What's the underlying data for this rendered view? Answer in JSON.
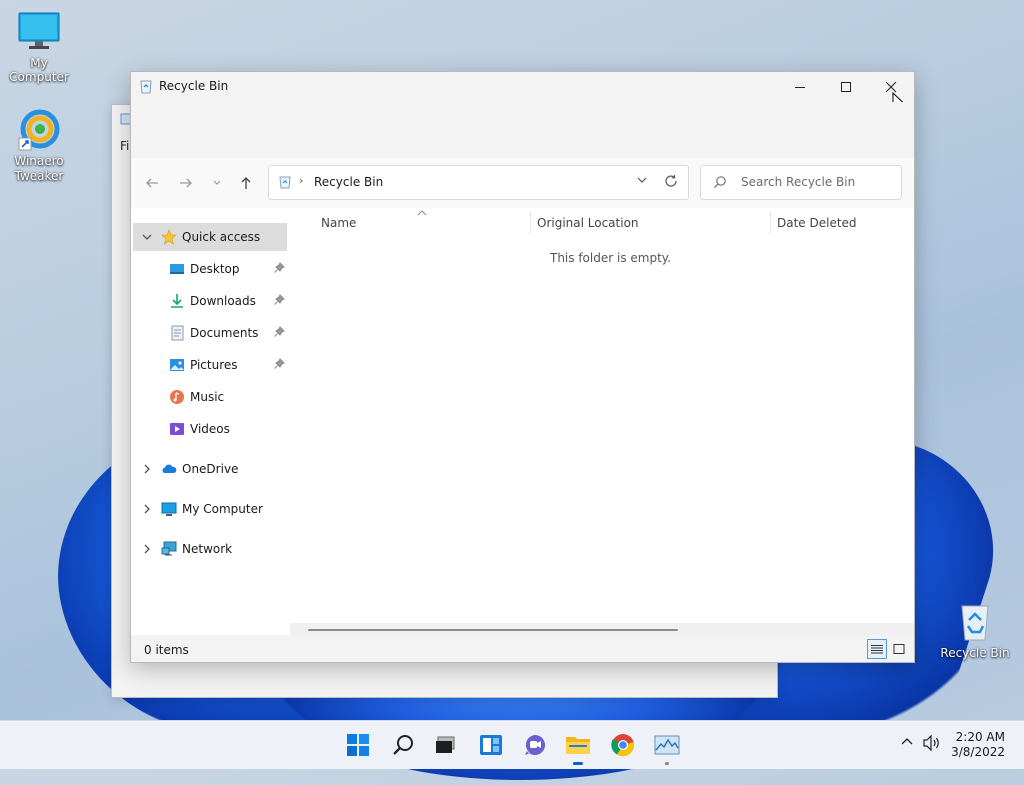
{
  "desktop": {
    "icons": [
      {
        "label": "My Computer",
        "icon": "monitor-icon"
      },
      {
        "label": "Winaero\nTweaker",
        "icon": "winaero-tweaker-icon"
      },
      {
        "label": "Recycle Bin",
        "icon": "recycle-bin-icon"
      }
    ]
  },
  "back_window": {
    "title_fragment": "Fi"
  },
  "window": {
    "title": "Recycle Bin",
    "controls": {
      "minimize": "minimize-icon",
      "maximize": "maximize-icon",
      "close": "close-icon"
    },
    "address": {
      "path_separator": "›",
      "location": "Recycle Bin"
    },
    "search": {
      "placeholder": "Search Recycle Bin"
    },
    "sidebar": {
      "quick_access": "Quick access",
      "pinned": [
        {
          "label": "Desktop",
          "icon": "desktop-folder-icon",
          "pinned": true
        },
        {
          "label": "Downloads",
          "icon": "downloads-icon",
          "pinned": true
        },
        {
          "label": "Documents",
          "icon": "documents-icon",
          "pinned": true
        },
        {
          "label": "Pictures",
          "icon": "pictures-icon",
          "pinned": true
        },
        {
          "label": "Music",
          "icon": "music-icon",
          "pinned": false
        },
        {
          "label": "Videos",
          "icon": "videos-icon",
          "pinned": false
        }
      ],
      "roots": [
        {
          "label": "OneDrive",
          "icon": "onedrive-icon"
        },
        {
          "label": "My Computer",
          "icon": "computer-icon"
        },
        {
          "label": "Network",
          "icon": "network-icon"
        }
      ]
    },
    "columns": [
      "Name",
      "Original Location",
      "Date Deleted"
    ],
    "empty_message": "This folder is empty.",
    "status": "0 items"
  },
  "taskbar": {
    "apps": [
      "start-icon",
      "search-icon",
      "task-view-icon",
      "widgets-icon",
      "chat-icon",
      "file-explorer-icon",
      "chrome-icon",
      "task-manager-icon"
    ],
    "time": "2:20 AM",
    "date": "3/8/2022"
  },
  "colors": {
    "accent": "#0067c0",
    "selection": "#dcdcdc",
    "folder_yellow": "#f4c534"
  }
}
